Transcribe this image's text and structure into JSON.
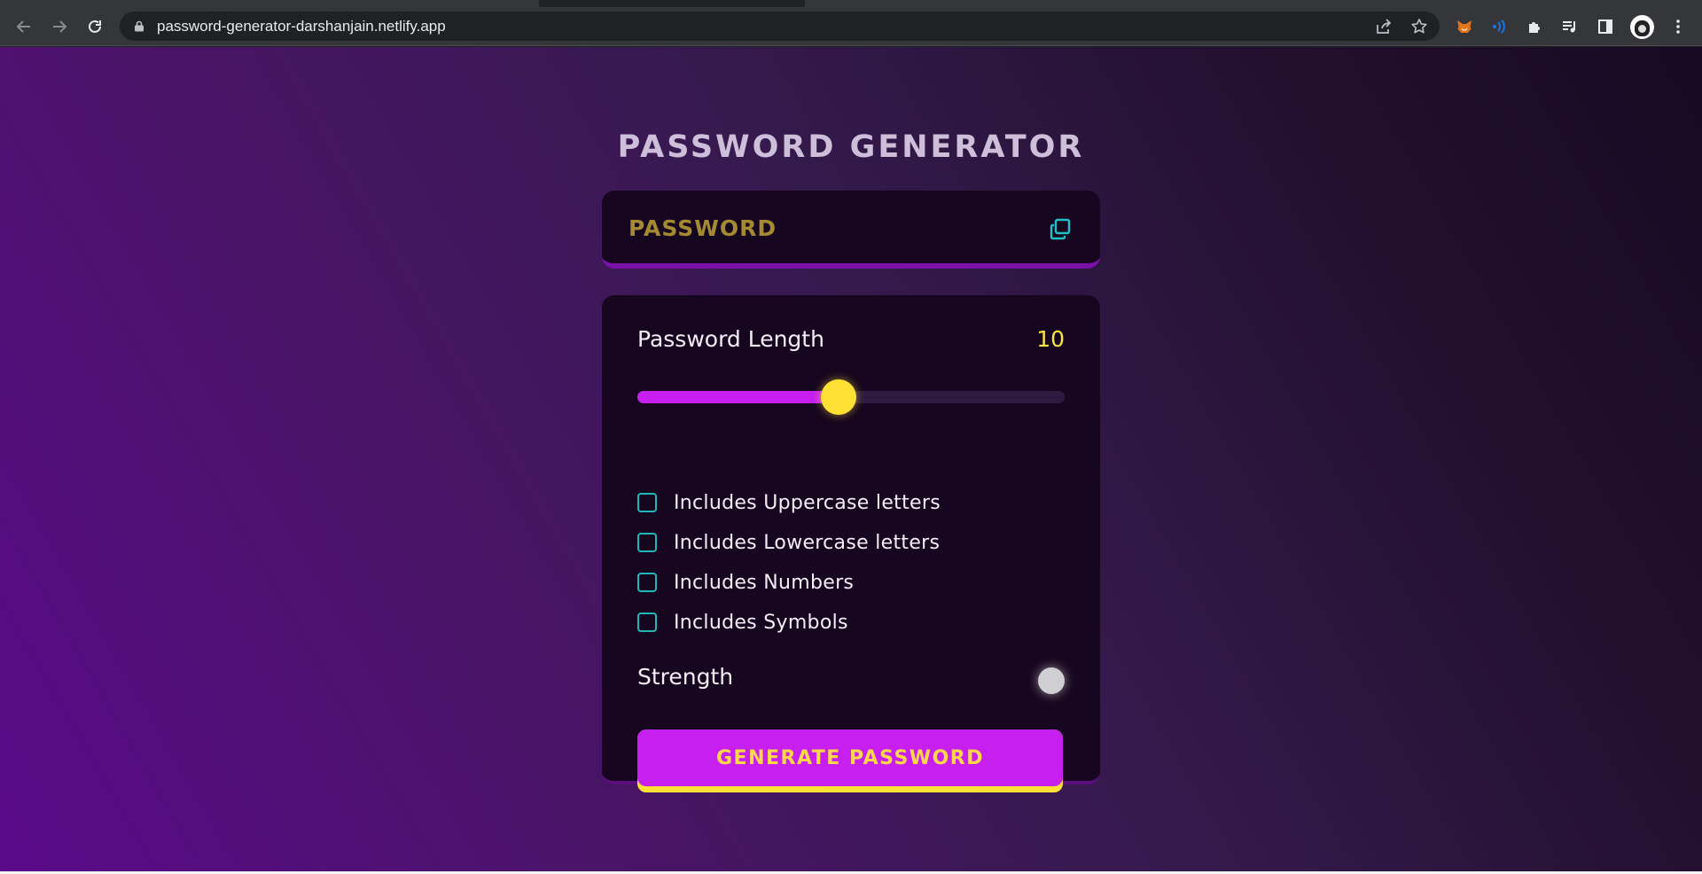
{
  "browser": {
    "url": "password-generator-darshanjain.netlify.app",
    "icons": {
      "back": "arrow-left-icon",
      "forward": "arrow-right-icon",
      "reload": "reload-icon",
      "lock": "lock-icon",
      "share": "share-icon",
      "bookmark": "star-icon",
      "extensions": [
        "metamask-fox-icon",
        "audio-waves-icon",
        "puzzle-icon",
        "media-queue-icon",
        "side-panel-icon"
      ],
      "menu": "kebab-menu-icon"
    }
  },
  "app": {
    "title": "PASSWORD GENERATOR",
    "password_display": "PASSWORD",
    "copy_icon": "copy-icon",
    "length_label": "Password Length",
    "length_value": "10",
    "length_fraction": 0.47,
    "options": [
      {
        "label": "Includes Uppercase letters",
        "checked": false
      },
      {
        "label": "Includes Lowercase letters",
        "checked": false
      },
      {
        "label": "Includes Numbers",
        "checked": false
      },
      {
        "label": "Includes Symbols",
        "checked": false
      }
    ],
    "strength_label": "Strength",
    "strength_color": "#cfcfd1",
    "generate_label": "GENERATE PASSWORD"
  },
  "colors": {
    "accent_magenta": "#c71ff0",
    "accent_yellow": "#ffe135",
    "checkbox_teal": "#1fb7b9",
    "card_bg": "#17061f"
  }
}
